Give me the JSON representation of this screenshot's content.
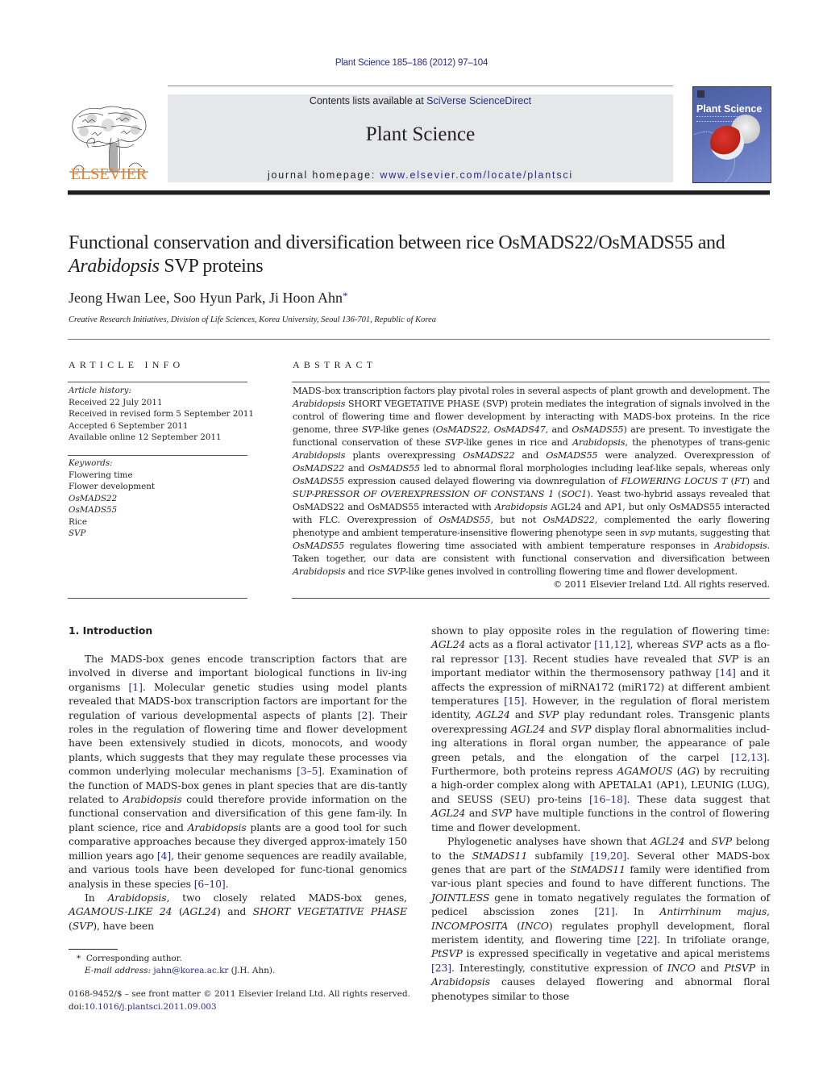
{
  "header": {
    "citation": "Plant Science 185–186 (2012) 97–104",
    "contents_prefix": "Contents lists available at ",
    "contents_link": "SciVerse ScienceDirect",
    "journal_title": "Plant Science",
    "homepage_prefix": "journal homepage: ",
    "homepage_link": "www.elsevier.com/locate/plantsci",
    "publisher_logo_text": "ELSEVIER",
    "cover_title": "Plant Science",
    "publisher_color": "#f07b1e",
    "link_color": "#2a2a8c"
  },
  "article": {
    "title_part1": "Functional conservation and diversification between rice OsMADS22/OsMADS55 and ",
    "title_italic": "Arabidopsis",
    "title_part2": " SVP proteins",
    "authors": "Jeong Hwan Lee, Soo Hyun Park, Ji Hoon Ahn",
    "corresponding_mark": "*",
    "affiliation": "Creative Research Initiatives, Division of Life Sciences, Korea University, Seoul 136-701, Republic of Korea"
  },
  "article_info": {
    "heading": "ARTICLE INFO",
    "history_label": "Article history:",
    "history": [
      "Received 22 July 2011",
      "Received in revised form 5 September 2011",
      "Accepted 6 September 2011",
      "Available online 12 September 2011"
    ],
    "keywords_label": "Keywords:",
    "keywords": [
      {
        "text": "Flowering time",
        "italic": false
      },
      {
        "text": "Flower development",
        "italic": false
      },
      {
        "text": "OsMADS22",
        "italic": true
      },
      {
        "text": "OsMADS55",
        "italic": true
      },
      {
        "text": "Rice",
        "italic": false
      },
      {
        "text": "SVP",
        "italic": true
      }
    ]
  },
  "abstract": {
    "heading": "ABSTRACT",
    "html": "MADS-box transcription factors play pivotal roles in several aspects of plant growth and development. The <i>Arabidopsis</i> SHORT VEGETATIVE PHASE (SVP) protein mediates the integration of signals involved in the control of flowering time and flower development by interacting with MADS-box proteins. In the rice genome, three <i>SVP</i>-like genes (<i>OsMADS22</i>, <i>OsMADS47</i>, and <i>OsMADS55</i>) are present. To investigate the functional conservation of these <i>SVP</i>-like genes in rice and <i>Arabidopsis</i>, the phenotypes of trans-genic <i>Arabidopsis</i> plants overexpressing <i>OsMADS22</i> and <i>OsMADS55</i> were analyzed. Overexpression of <i>OsMADS22</i> and <i>OsMADS55</i> led to abnormal floral morphologies including leaf-like sepals, whereas only <i>OsMADS55</i> expression caused delayed flowering via downregulation of <i>FLOWERING LOCUS T</i> (<i>FT</i>) and <i>SUP-PRESSOR OF OVEREXPRESSION OF CONSTANS 1</i> (<i>SOC1</i>). Yeast two-hybrid assays revealed that OsMADS22 and OsMADS55 interacted with <i>Arabidopsis</i> AGL24 and AP1, but only OsMADS55 interacted with FLC. Overexpression of <i>OsMADS55</i>, but not <i>OsMADS22</i>, complemented the early flowering phenotype and ambient temperature-insensitive flowering phenotype seen in <i>svp</i> mutants, suggesting that <i>OsMADS55</i> regulates flowering time associated with ambient temperature responses in <i>Arabidopsis</i>. Taken together, our data are consistent with functional conservation and diversification between <i>Arabidopsis</i> and rice <i>SVP</i>-like genes involved in controlling flowering time and flower development.",
    "copyright": "© 2011 Elsevier Ireland Ltd. All rights reserved."
  },
  "introduction": {
    "heading": "1.  Introduction",
    "left_col_html": [
      "The MADS-box genes encode transcription factors that are involved in diverse and important biological functions in liv-ing organisms <span class=\"link\">[1]</span>. Molecular genetic studies using model plants revealed that MADS-box transcription factors are important for the regulation of various developmental aspects of plants <span class=\"link\">[2]</span>. Their roles in the regulation of flowering time and flower development have been extensively studied in dicots, monocots, and woody plants, which suggests that they may regulate these processes via common underlying molecular mechanisms <span class=\"link\">[3–5]</span>. Examination of the function of MADS-box genes in plant species that are dis-tantly related to <i>Arabidopsis</i> could therefore provide information on the functional conservation and diversification of this gene fam-ily. In plant science, rice and <i>Arabidopsis</i> plants are a good tool for such comparative approaches because they diverged approx-imately 150 million years ago <span class=\"link\">[4]</span>, their genome sequences are readily available, and various tools have been developed for func-tional genomics analysis in these species <span class=\"link\">[6–10]</span>.",
      "In <i>Arabidopsis</i>, two closely related MADS-box genes, <i>AGAMOUS-LIKE 24</i> (<i>AGL24</i>) and <i>SHORT VEGETATIVE PHASE</i> (<i>SVP</i>), have been"
    ],
    "right_col_html": [
      "shown to play opposite roles in the regulation of flowering time: <i>AGL24</i> acts as a floral activator <span class=\"link\">[11,12]</span>, whereas <i>SVP</i> acts as a flo-ral repressor <span class=\"link\">[13]</span>. Recent studies have revealed that <i>SVP</i> is an important mediator within the thermosensory pathway <span class=\"link\">[14]</span> and it affects the expression of miRNA172 (miR172) at different ambient temperatures <span class=\"link\">[15]</span>. However, in the regulation of floral meristem identity, <i>AGL24</i> and <i>SVP</i> play redundant roles. Transgenic plants overexpressing <i>AGL24</i> and <i>SVP</i> display floral abnormalities includ-ing alterations in floral organ number, the appearance of pale green petals, and the elongation of the carpel <span class=\"link\">[12,13]</span>. Furthermore, both proteins repress <i>AGAMOUS</i> (<i>AG</i>) by recruiting a high-order complex along with APETALA1 (AP1), LEUNIG (LUG), and SEUSS (SEU) pro-teins <span class=\"link\">[16–18]</span>. These data suggest that <i>AGL24</i> and <i>SVP</i> have multiple functions in the control of flowering time and flower development.",
      "Phylogenetic analyses have shown that <i>AGL24</i> and <i>SVP</i> belong to the <i>StMADS11</i> subfamily <span class=\"link\">[19,20]</span>. Several other MADS-box genes that are part of the <i>StMADS11</i> family were identified from var-ious plant species and found to have different functions. The <i>JOINTLESS</i> gene in tomato negatively regulates the formation of pedicel abscission zones <span class=\"link\">[21]</span>. In <i>Antirrhinum majus</i>, <i>INCOMPOSITA</i> (<i>INCO</i>) regulates prophyll development, floral meristem identity, and flowering time <span class=\"link\">[22]</span>. In trifoliate orange, <i>PtSVP</i> is expressed specifically in vegetative and apical meristems <span class=\"link\">[23]</span>. Interestingly, constitutive expression of <i>INCO</i> and <i>PtSVP</i> in <i>Arabidopsis</i> causes delayed flowering and abnormal floral phenotypes similar to those"
    ]
  },
  "footnote": {
    "mark": "*",
    "corresponding": "Corresponding author.",
    "email_label": "E-mail address:",
    "email": "jahn@korea.ac.kr",
    "email_suffix": " (J.H. Ahn)."
  },
  "front_matter": {
    "issn_line": "0168-9452/$ – see front matter © 2011 Elsevier Ireland Ltd. All rights reserved.",
    "doi_prefix": "doi:",
    "doi": "10.1016/j.plantsci.2011.09.003"
  }
}
